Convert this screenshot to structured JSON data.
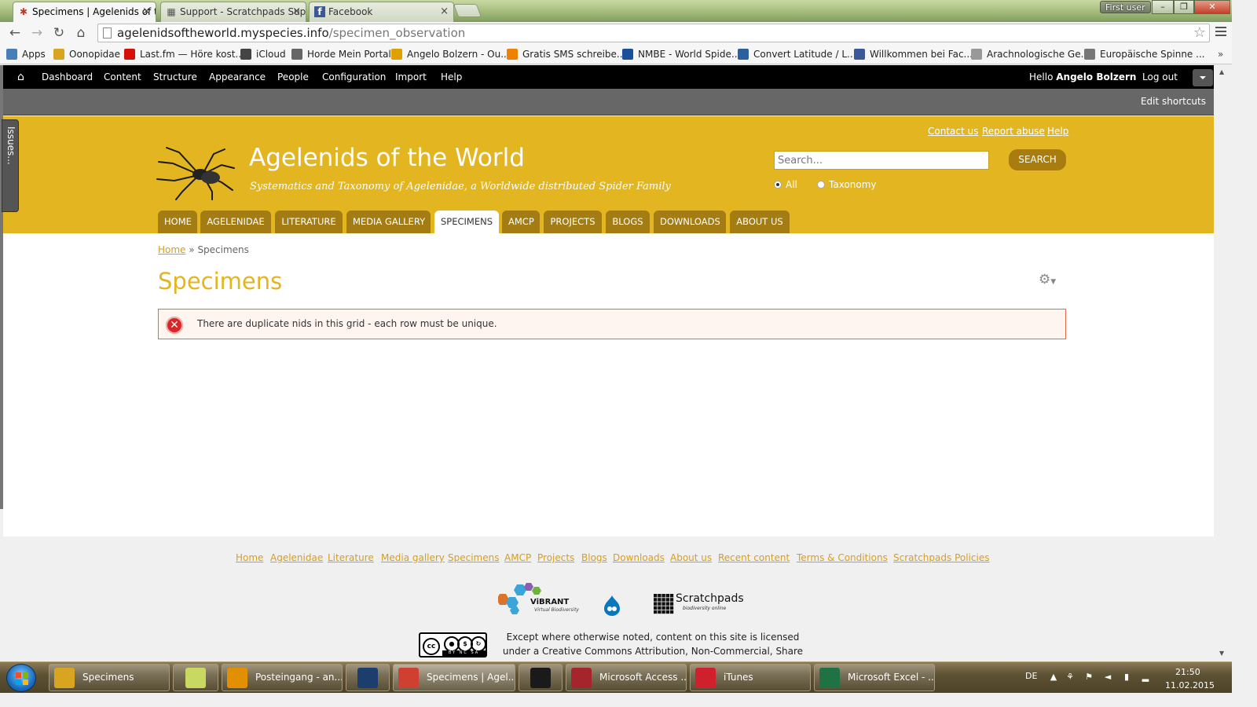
{
  "browser": {
    "tabs": [
      {
        "title": "Specimens | Agelenids of t",
        "close": "×",
        "icon": "spider-favicon",
        "active": true
      },
      {
        "title": "Support - Scratchpads Sup",
        "close": "×",
        "icon": "scratchpads-favicon",
        "active": false
      },
      {
        "title": "Facebook",
        "close": "×",
        "icon": "facebook-favicon",
        "active": false
      }
    ],
    "profile": "First user",
    "window_buttons": {
      "minimize": "–",
      "maximize": "❐",
      "close": "✕"
    },
    "url_host": "agelenidsoftheworld.myspecies.info",
    "url_path": "/specimen_observation",
    "bookmarks": [
      {
        "label": "Apps",
        "icon": "apps-grid-icon",
        "color": "#4a7ebb"
      },
      {
        "label": "Oonopidae",
        "icon": "folder-icon",
        "color": "#d9a520"
      },
      {
        "label": "Last.fm — Höre kost...",
        "icon": "lastfm-icon",
        "color": "#d51007"
      },
      {
        "label": "iCloud",
        "icon": "apple-icon",
        "color": "#444444"
      },
      {
        "label": "Horde Mein Portal",
        "icon": "mail-icon",
        "color": "#666666"
      },
      {
        "label": "Angelo Bolzern - Ou...",
        "icon": "outlook-icon",
        "color": "#e0a000"
      },
      {
        "label": "Gratis SMS schreibe...",
        "icon": "sms-icon",
        "color": "#f08000"
      },
      {
        "label": "NMBE - World Spide...",
        "icon": "nmbe-icon",
        "color": "#1a4f9c"
      },
      {
        "label": "Convert Latitude / L...",
        "icon": "fcc-icon",
        "color": "#2a5fa0"
      },
      {
        "label": "Willkommen bei Fac...",
        "icon": "facebook-icon",
        "color": "#3b5998"
      },
      {
        "label": "Arachnologische Ge...",
        "icon": "page-icon",
        "color": "#999999"
      },
      {
        "label": "Europäische Spinne ...",
        "icon": "spider-web-icon",
        "color": "#777777"
      }
    ],
    "bookmarks_more": "»"
  },
  "admin": {
    "items": [
      "Dashboard",
      "Content",
      "Structure",
      "Appearance",
      "People",
      "Configuration",
      "Import",
      "Help"
    ],
    "hello": "Hello",
    "user_name": "Angelo Bolzern",
    "logout": "Log out",
    "edit_shortcuts": "Edit shortcuts"
  },
  "issues_tab": "Issues...",
  "site": {
    "name": "Agelenids of the World",
    "slogan": "Systematics and Taxonomy of Agelenidae, a Worldwide distributed Spider Family",
    "top_links": [
      "Contact us",
      "Report abuse",
      "Help"
    ],
    "search_placeholder": "Search...",
    "search_button": "SEARCH",
    "search_scope": [
      {
        "label": "All",
        "selected": true
      },
      {
        "label": "Taxonomy",
        "selected": false
      }
    ],
    "nav": [
      "HOME",
      "AGELENIDAE",
      "LITERATURE",
      "MEDIA GALLERY",
      "SPECIMENS",
      "AMCP",
      "PROJECTS",
      "BLOGS",
      "DOWNLOADS",
      "ABOUT US"
    ],
    "active_nav": "SPECIMENS",
    "accent_color": "#e3b521",
    "nav_tab_color": "#a37c14"
  },
  "page": {
    "breadcrumb_home": "Home",
    "breadcrumb_sep": "»",
    "breadcrumb_current": "Specimens",
    "title": "Specimens",
    "gear_icon": "gear-icon",
    "error_message": "There are duplicate nids in this grid - each row must be unique.",
    "error_color": "#d8262b"
  },
  "footer": {
    "links": [
      "Home",
      "Agelenidae",
      "Literature",
      "Media gallery",
      "Specimens",
      "AMCP",
      "Projects",
      "Blogs",
      "Downloads",
      "About us",
      "Recent content",
      "Terms & Conditions",
      "Scratchpads Policies"
    ],
    "vibrant": "ViBRANT",
    "vibrant_sub": "Virtual Biodiversity",
    "scratchpads": "Scratchpads",
    "scratchpads_sub": "biodiversity online",
    "cc_strip": "BY NC SA",
    "license_line1": "Except where otherwise noted, content on this site is licensed",
    "license_line2": "under a Creative Commons Attribution, Non-Commercial, Share"
  },
  "taskbar": {
    "items": [
      {
        "label": "Specimens",
        "icon": "folder-icon",
        "color": "#d9a520",
        "active": false
      },
      {
        "label": "",
        "icon": "sticky-notes-icon",
        "color": "#c8d860",
        "active": false
      },
      {
        "label": "Posteingang - an...",
        "icon": "outlook-icon",
        "color": "#e09000",
        "active": false
      },
      {
        "label": "",
        "icon": "photoshop-icon",
        "color": "#1c3e6e",
        "active": false
      },
      {
        "label": "Specimens | Agel...",
        "icon": "chrome-icon",
        "color": "#d04030",
        "active": true
      },
      {
        "label": "",
        "icon": "terminal-icon",
        "color": "#1a1a1a",
        "active": false
      },
      {
        "label": "Microsoft Access ...",
        "icon": "access-icon",
        "color": "#a4262c",
        "active": false
      },
      {
        "label": "iTunes",
        "icon": "itunes-icon",
        "color": "#d0202e",
        "active": false
      },
      {
        "label": "Microsoft Excel - ...",
        "icon": "excel-icon",
        "color": "#207245",
        "active": false
      }
    ],
    "language": "DE",
    "time": "21:50",
    "date": "11.02.2015"
  }
}
